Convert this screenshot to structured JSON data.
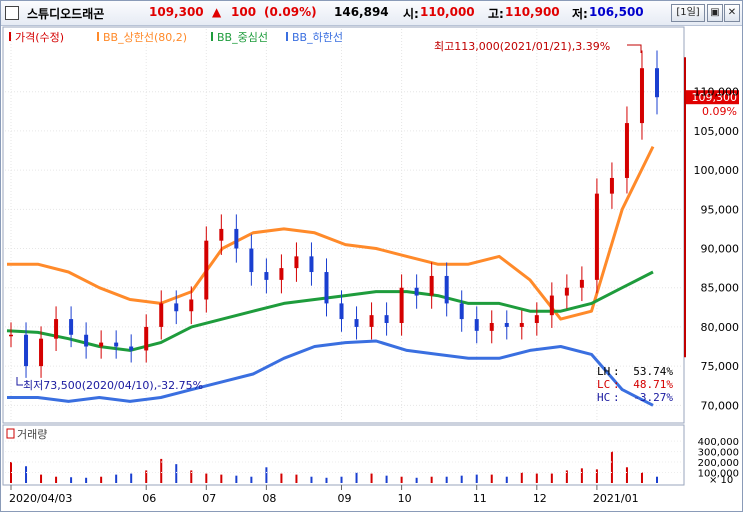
{
  "header": {
    "stock_name": "스튜디오드래곤",
    "price": "109,300",
    "change_arrow": "▲",
    "change": "100",
    "change_pct": "(0.09%)",
    "volume": "146,894",
    "open_label": "시:",
    "open": "110,000",
    "high_label": "고:",
    "high": "110,900",
    "low_label": "저:",
    "low": "106,500",
    "period_button": "[1일]",
    "colors": {
      "up": "#e00000",
      "down": "#0000cc"
    }
  },
  "legend": {
    "items": [
      {
        "label": "가격(수정)",
        "color": "#d40000"
      },
      {
        "label": "BB_상한선(80,2)",
        "color": "#ff8a2a"
      },
      {
        "label": "BB_중심선",
        "color": "#1e9c3c"
      },
      {
        "label": "BB_하한선",
        "color": "#3a6fe0"
      }
    ]
  },
  "annotations": {
    "max_text": "최고113,000(2021/01/21),3.39%",
    "min_text": "최저73,500(2020/04/10),-32.75%",
    "current_price_tag": "109,300",
    "current_pct_tag": "0.09%",
    "stats": [
      {
        "label": "LH",
        "value": "53.74%",
        "color": "#000000"
      },
      {
        "label": "LC",
        "value": "48.71%",
        "color": "#d40000"
      },
      {
        "label": "HC",
        "value": "-3.27%",
        "color": "#1a1aa0"
      }
    ]
  },
  "volume_panel": {
    "title": "거래량",
    "ticks": [
      "400,000",
      "300,000",
      "200,000",
      "100,000"
    ],
    "multiplier": "× 10"
  },
  "chart_data": {
    "type": "candlestick",
    "title": "",
    "xlabel": "",
    "ylabel": "",
    "ylim": [
      68000,
      118000
    ],
    "y_ticks": [
      70000,
      75000,
      80000,
      85000,
      90000,
      95000,
      100000,
      105000,
      110000
    ],
    "y_tick_labels": [
      "70,000",
      "75,000",
      "80,000",
      "85,000",
      "90,000",
      "95,000",
      "100,000",
      "105,000",
      "110,000"
    ],
    "x_tick_labels": [
      "2020/04/03",
      "06",
      "07",
      "08",
      "09",
      "10",
      "11",
      "12",
      "2021/01"
    ],
    "grid": true,
    "close_series": [
      {
        "date": "2020/04/03",
        "close": 79000
      },
      {
        "date": "2020/04/10",
        "close": 75000
      },
      {
        "date": "2020/04/17",
        "close": 78500
      },
      {
        "date": "2020/04/24",
        "close": 81000
      },
      {
        "date": "2020/05/01",
        "close": 79000
      },
      {
        "date": "2020/05/08",
        "close": 77500
      },
      {
        "date": "2020/05/15",
        "close": 78000
      },
      {
        "date": "2020/05/22",
        "close": 77500
      },
      {
        "date": "2020/05/29",
        "close": 77000
      },
      {
        "date": "2020/06/05",
        "close": 80000
      },
      {
        "date": "2020/06/12",
        "close": 83000
      },
      {
        "date": "2020/06/19",
        "close": 82000
      },
      {
        "date": "2020/06/26",
        "close": 83500
      },
      {
        "date": "2020/07/03",
        "close": 91000
      },
      {
        "date": "2020/07/10",
        "close": 92500
      },
      {
        "date": "2020/07/17",
        "close": 90000
      },
      {
        "date": "2020/07/24",
        "close": 87000
      },
      {
        "date": "2020/07/31",
        "close": 86000
      },
      {
        "date": "2020/08/07",
        "close": 87500
      },
      {
        "date": "2020/08/14",
        "close": 89000
      },
      {
        "date": "2020/08/21",
        "close": 87000
      },
      {
        "date": "2020/08/28",
        "close": 83000
      },
      {
        "date": "2020/09/04",
        "close": 81000
      },
      {
        "date": "2020/09/11",
        "close": 80000
      },
      {
        "date": "2020/09/18",
        "close": 81500
      },
      {
        "date": "2020/09/25",
        "close": 80500
      },
      {
        "date": "2020/10/02",
        "close": 85000
      },
      {
        "date": "2020/10/09",
        "close": 84000
      },
      {
        "date": "2020/10/16",
        "close": 86500
      },
      {
        "date": "2020/10/23",
        "close": 83000
      },
      {
        "date": "2020/10/30",
        "close": 81000
      },
      {
        "date": "2020/11/06",
        "close": 79500
      },
      {
        "date": "2020/11/13",
        "close": 80500
      },
      {
        "date": "2020/11/20",
        "close": 80000
      },
      {
        "date": "2020/11/27",
        "close": 80500
      },
      {
        "date": "2020/12/04",
        "close": 81500
      },
      {
        "date": "2020/12/11",
        "close": 84000
      },
      {
        "date": "2020/12/18",
        "close": 85000
      },
      {
        "date": "2020/12/25",
        "close": 86000
      },
      {
        "date": "2021/01/01",
        "close": 97000
      },
      {
        "date": "2021/01/08",
        "close": 99000
      },
      {
        "date": "2021/01/15",
        "close": 106000
      },
      {
        "date": "2021/01/21",
        "close": 113000
      },
      {
        "date": "2021/01/22",
        "close": 109300
      }
    ],
    "series": [
      {
        "name": "BB_상한선(80,2)",
        "values": [
          88000,
          88000,
          87000,
          85000,
          83500,
          83000,
          84500,
          90000,
          92000,
          92500,
          92000,
          90500,
          90000,
          89000,
          88000,
          88000,
          89000,
          86000,
          81000,
          82000,
          95000,
          103000
        ]
      },
      {
        "name": "BB_중심선",
        "values": [
          79500,
          79300,
          78500,
          77500,
          77000,
          78000,
          80000,
          81000,
          82000,
          83000,
          83500,
          84000,
          84500,
          84500,
          84000,
          83000,
          83000,
          82000,
          82000,
          83000,
          85000,
          87000
        ]
      },
      {
        "name": "BB_하한선",
        "values": [
          71000,
          71000,
          70500,
          71000,
          70500,
          71000,
          72000,
          73000,
          74000,
          76000,
          77500,
          78000,
          78200,
          77000,
          76500,
          76000,
          76000,
          77000,
          77500,
          76500,
          72000,
          70000
        ]
      }
    ],
    "volume": [
      200000,
      160000,
      80000,
      60000,
      55000,
      50000,
      60000,
      80000,
      90000,
      120000,
      230000,
      180000,
      120000,
      90000,
      80000,
      70000,
      60000,
      150000,
      90000,
      80000,
      60000,
      50000,
      60000,
      100000,
      90000,
      70000,
      60000,
      50000,
      60000,
      60000,
      70000,
      80000,
      80000,
      60000,
      100000,
      90000,
      90000,
      120000,
      140000,
      130000,
      300000,
      150000,
      100000,
      60000
    ]
  }
}
